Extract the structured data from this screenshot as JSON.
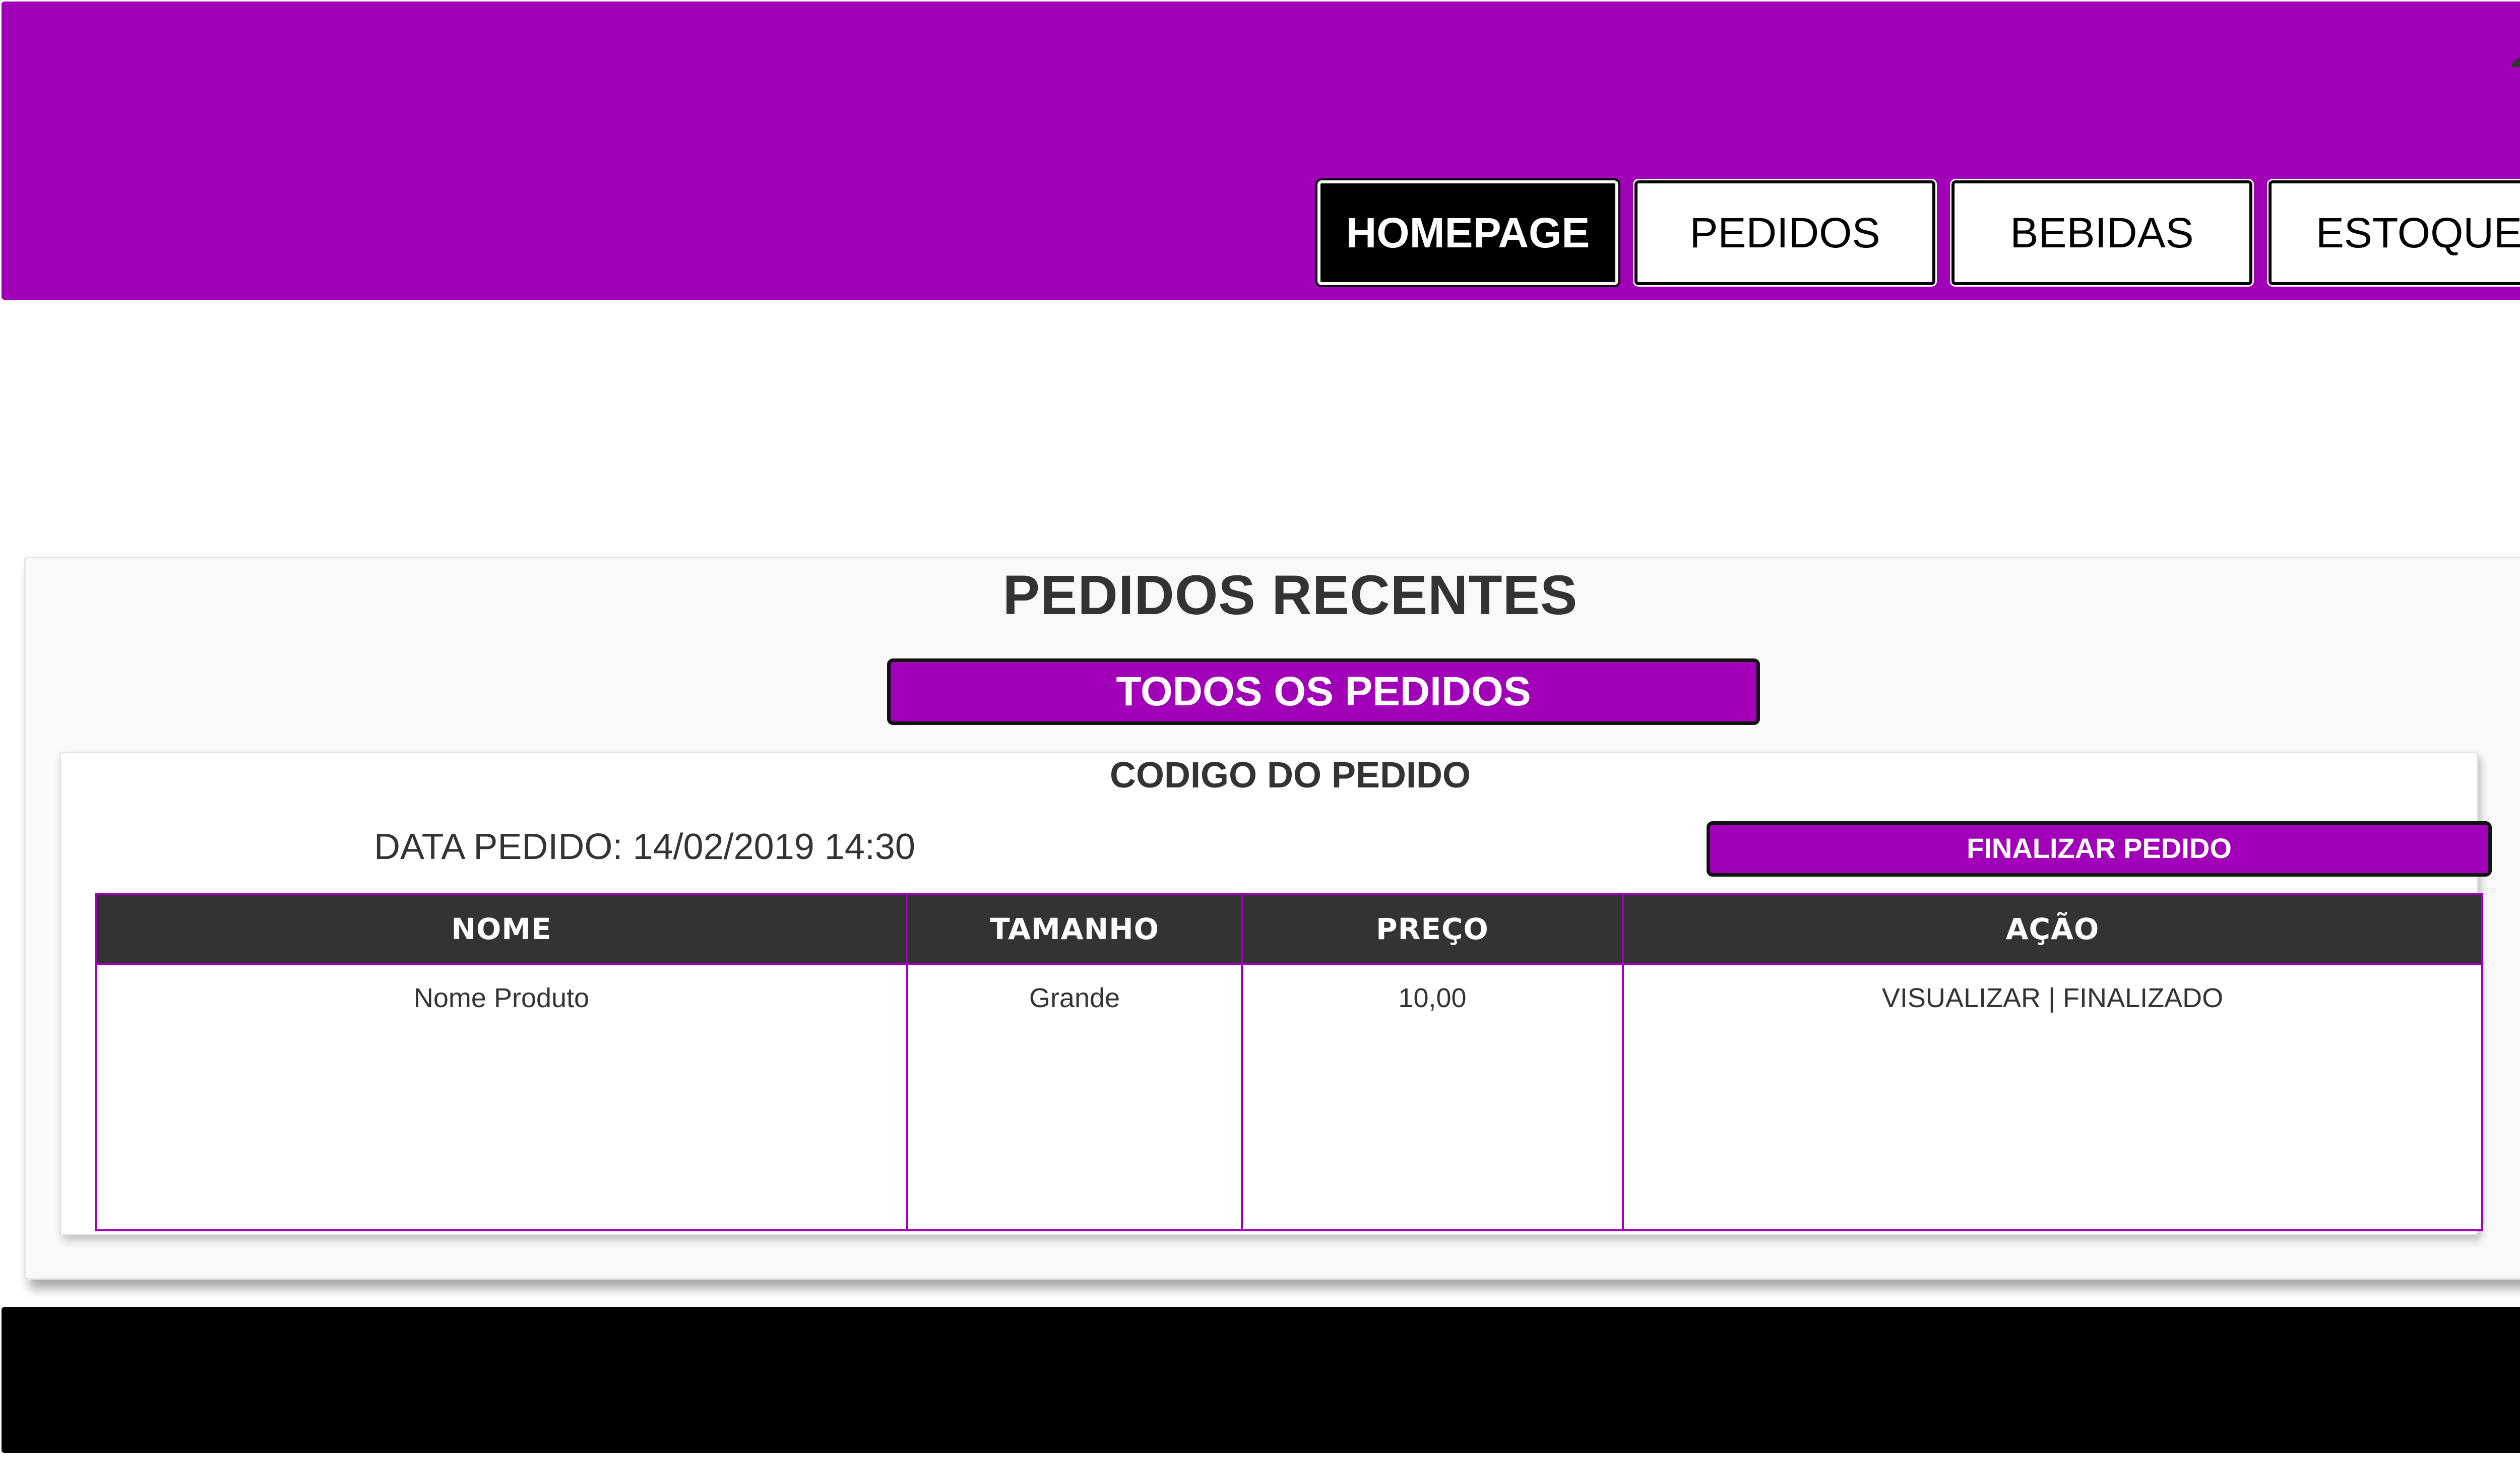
{
  "header": {
    "nav": [
      {
        "label": "HOMEPAGE",
        "active": true
      },
      {
        "label": "PEDIDOS",
        "active": false
      },
      {
        "label": "BEBIDAS",
        "active": false
      },
      {
        "label": "ESTOQUE",
        "active": false
      }
    ],
    "user_icon": "user-account-icon"
  },
  "main": {
    "title": "PEDIDOS RECENTES",
    "all_orders_label": "TODOS OS PEDIDOS",
    "order": {
      "code_label": "CODIGO DO PEDIDO",
      "date_label": "DATA PEDIDO:",
      "date_value": "14/02/2019 14:30",
      "finish_label": "FINALIZAR PEDIDO",
      "table": {
        "headers": [
          "NOME",
          "TAMANHO",
          "PREÇO",
          "AÇÃO"
        ],
        "rows": [
          {
            "nome": "Nome Produto",
            "tamanho": "Grande",
            "preco": "10,00",
            "acao_view": "VISUALIZAR",
            "acao_separator": "|",
            "acao_done": "FINALIZADO"
          }
        ]
      }
    }
  },
  "colors": {
    "brand": "#a200b8",
    "header_dark": "#333333",
    "footer": "#000000",
    "active_nav": "#000000"
  }
}
